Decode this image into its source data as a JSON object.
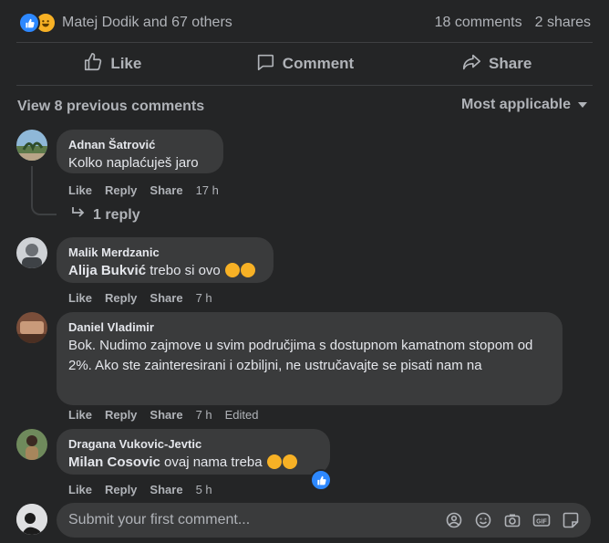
{
  "post": {
    "reactions_text": "Matej Dodik and 67 others",
    "comments_count": "18 comments",
    "shares_count": "2 shares"
  },
  "actions": {
    "like": "Like",
    "comment": "Comment",
    "share": "Share"
  },
  "comments_header": {
    "view_previous": "View 8 previous comments",
    "sort": "Most applicable"
  },
  "comments": [
    {
      "author": "Adnan Šatrović",
      "mention": "",
      "text": "Kolko naplaćuješ jaro",
      "time": "17 h",
      "edited": "",
      "replies_label": "1 reply"
    },
    {
      "author": "Malik Merdzanic",
      "mention": "Alija Bukvić",
      "text": "trebo si ovo",
      "time": "7 h",
      "edited": ""
    },
    {
      "author": "Daniel Vladimir",
      "mention": "",
      "text": "Bok. Nudimo zajmove u svim područjima s dostupnom kamatnom stopom od 2%. Ako ste zainteresirani i ozbiljni, ne ustručavajte se pisati nam na",
      "time": "7 h",
      "edited": "Edited"
    },
    {
      "author": "Dragana Vukovic-Jevtic",
      "mention": "Milan Cosovic",
      "text": "ovaj nama treba",
      "time": "5 h",
      "edited": ""
    }
  ],
  "comment_actions": {
    "like": "Like",
    "reply": "Reply",
    "share": "Share"
  },
  "composer": {
    "placeholder": "Submit your first comment..."
  },
  "colors": {
    "background": "#242526",
    "bubble": "#3a3b3c",
    "accent": "#2d88ff",
    "muted": "#b0b3b8"
  }
}
